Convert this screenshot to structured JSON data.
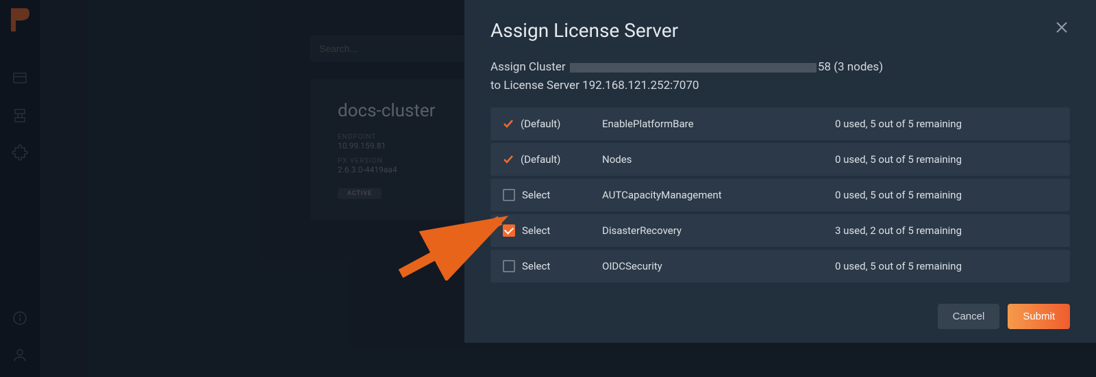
{
  "search": {
    "placeholder": "Search..."
  },
  "cluster_card": {
    "title": "docs-cluster",
    "endpoint_label": "ENDPOINT",
    "endpoint_value": "10.99.159.81",
    "version_label": "PX VERSION",
    "version_value": "2.6.3.0-4419aa4",
    "status": "ACTIVE"
  },
  "modal": {
    "title": "Assign License Server",
    "subtitle_prefix": "Assign Cluster ",
    "subtitle_suffix": "58 (3 nodes)",
    "subtitle_line2": "to License Server 192.168.121.252:7070",
    "rows": [
      {
        "label": "(Default)",
        "is_default": true,
        "checked": true,
        "name": "EnablePlatformBare",
        "usage": "0 used, 5 out of 5 remaining"
      },
      {
        "label": "(Default)",
        "is_default": true,
        "checked": true,
        "name": "Nodes",
        "usage": "0 used, 5 out of 5 remaining"
      },
      {
        "label": "Select",
        "is_default": false,
        "checked": false,
        "name": "AUTCapacityManagement",
        "usage": "0 used, 5 out of 5 remaining"
      },
      {
        "label": "Select",
        "is_default": false,
        "checked": true,
        "name": "DisasterRecovery",
        "usage": "3 used, 2 out of 5 remaining"
      },
      {
        "label": "Select",
        "is_default": false,
        "checked": false,
        "name": "OIDCSecurity",
        "usage": "0 used, 5 out of 5 remaining"
      }
    ],
    "cancel": "Cancel",
    "submit": "Submit"
  }
}
